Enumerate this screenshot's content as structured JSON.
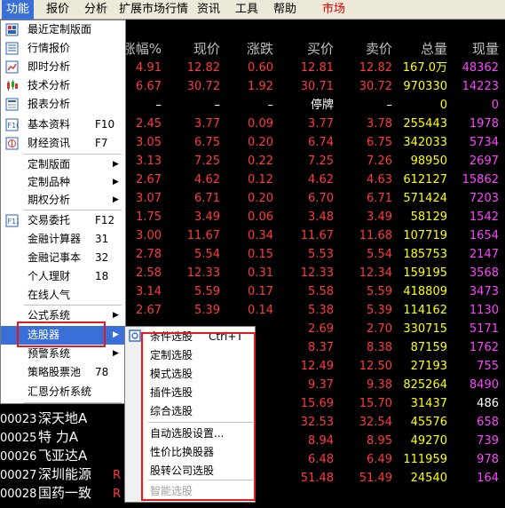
{
  "menubar": {
    "items": [
      "功能",
      "报价",
      "分析",
      "扩展市场行情",
      "资讯",
      "工具",
      "帮助",
      "市场"
    ]
  },
  "table": {
    "headers": [
      "涨幅%",
      "现价",
      "涨跌",
      "买价",
      "卖价",
      "总量",
      "现量"
    ],
    "rows": [
      [
        "4.91",
        "12.82",
        "0.60",
        "12.81",
        "12.82",
        "167.0万",
        "48362"
      ],
      [
        "6.67",
        "30.72",
        "1.92",
        "30.71",
        "30.72",
        "970330",
        "14223"
      ],
      [
        "–",
        "–",
        "–",
        "停牌",
        "–",
        "0",
        "0"
      ],
      [
        "2.45",
        "3.77",
        "0.09",
        "3.77",
        "3.78",
        "255443",
        "1978"
      ],
      [
        "3.05",
        "6.75",
        "0.20",
        "6.74",
        "6.75",
        "342033",
        "5734"
      ],
      [
        "3.13",
        "7.25",
        "0.22",
        "7.25",
        "7.26",
        "98950",
        "2697"
      ],
      [
        "2.67",
        "4.62",
        "0.12",
        "4.62",
        "4.63",
        "612127",
        "15862"
      ],
      [
        "3.07",
        "6.71",
        "0.20",
        "6.70",
        "6.71",
        "571424",
        "7203"
      ],
      [
        "1.75",
        "3.49",
        "0.06",
        "3.48",
        "3.49",
        "58129",
        "1542"
      ],
      [
        "3.00",
        "11.67",
        "0.34",
        "11.67",
        "11.68",
        "107719",
        "1654"
      ],
      [
        "2.78",
        "5.54",
        "0.15",
        "5.53",
        "5.54",
        "185753",
        "2147"
      ],
      [
        "2.58",
        "12.33",
        "0.31",
        "12.33",
        "12.34",
        "159195",
        "3568"
      ],
      [
        "3.14",
        "5.59",
        "0.17",
        "5.58",
        "5.59",
        "418809",
        "3473"
      ],
      [
        "2.67",
        "5.39",
        "0.14",
        "5.38",
        "5.39",
        "114162",
        "1130"
      ],
      [
        "",
        "",
        "",
        "2.69",
        "2.70",
        "330715",
        "5171"
      ],
      [
        "",
        "",
        "",
        "8.37",
        "8.38",
        "87159",
        "1762"
      ],
      [
        "",
        "",
        "",
        "12.49",
        "12.50",
        "27193",
        "755"
      ],
      [
        "",
        "",
        "",
        "9.37",
        "9.38",
        "825264",
        "8490"
      ],
      [
        "",
        "",
        "",
        "15.69",
        "15.70",
        "31437",
        "486"
      ],
      [
        "",
        "",
        "",
        "32.53",
        "32.54",
        "45576",
        "658"
      ],
      [
        "",
        "",
        "",
        "8.94",
        "8.95",
        "49270",
        "739"
      ],
      [
        "",
        "",
        "",
        "6.48",
        "6.49",
        "111959",
        "978"
      ],
      [
        "",
        "",
        "",
        "51.48",
        "51.49",
        "24540",
        "164"
      ]
    ],
    "stocks": [
      {
        "code": "00023",
        "name": "深天地A"
      },
      {
        "code": "00025",
        "name": "特 力A"
      },
      {
        "code": "00026",
        "name": "飞亚达A"
      },
      {
        "code": "00027",
        "name": "深圳能源"
      },
      {
        "code": "00028",
        "name": "国药一致"
      }
    ],
    "r_marks": [
      "R",
      "R"
    ]
  },
  "menu": {
    "items": [
      {
        "label": "最近定制版面",
        "icon": "layout-icon"
      },
      {
        "label": "行情报价",
        "icon": "quote-icon"
      },
      {
        "label": "即时分析",
        "icon": "line-chart-icon"
      },
      {
        "label": "技术分析",
        "icon": "candlestick-icon"
      },
      {
        "label": "报表分析",
        "icon": "report-icon"
      },
      {
        "label": "基本资料",
        "shortcut": "F10",
        "icon": "f10-icon"
      },
      {
        "label": "财经资讯",
        "shortcut": "F7",
        "icon": "news-icon"
      },
      {
        "label": "定制版面"
      },
      {
        "label": "定制品种"
      },
      {
        "label": "期权分析"
      },
      {
        "label": "交易委托",
        "shortcut": "F12",
        "icon": "f12-icon"
      },
      {
        "label": "金融计算器",
        "shortcut": "31"
      },
      {
        "label": "金融记事本",
        "shortcut": "32"
      },
      {
        "label": "个人理财",
        "shortcut": "18"
      },
      {
        "label": "在线人气"
      },
      {
        "label": "公式系统"
      },
      {
        "label": "选股器"
      },
      {
        "label": "预警系统"
      },
      {
        "label": "策略股票池",
        "shortcut": "78"
      },
      {
        "label": "汇恩分析系统"
      }
    ]
  },
  "submenu": {
    "items": [
      {
        "label": "条件选股",
        "shortcut": "Ctrl+T"
      },
      {
        "label": "定制选股"
      },
      {
        "label": "模式选股"
      },
      {
        "label": "插件选股"
      },
      {
        "label": "综合选股"
      },
      {
        "label": "自动选股设置..."
      },
      {
        "label": "性价比换股器"
      },
      {
        "label": "股转公司选股"
      },
      {
        "label": "智能选股"
      }
    ]
  },
  "colors": {
    "highlight": "#3a6fd8",
    "annotation": "#e21c1c",
    "up": "#ff3b3b",
    "volume": "#ffff00",
    "current_volume": "#ff44ff"
  }
}
